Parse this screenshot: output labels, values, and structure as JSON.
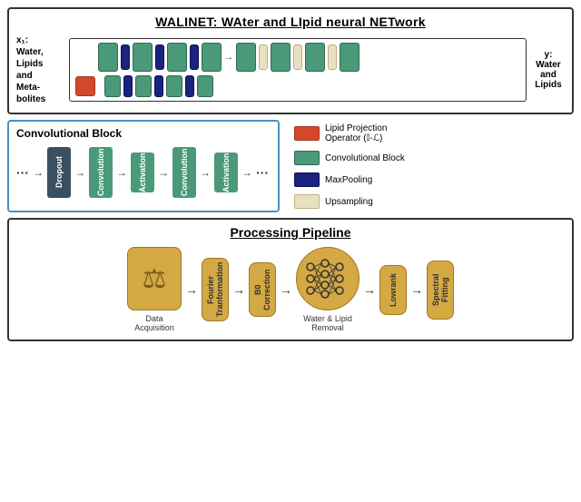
{
  "walinet": {
    "title": "WALINET: WAter and LIpid neural NETwork",
    "x1_label": "x₁:",
    "x1_description": "Water,\nLipids\nand\nMeta-\nbolites",
    "y_label": "y:",
    "y_description": "Water\nand\nLipids"
  },
  "conv_block": {
    "title": "Convolutional Block",
    "elements": [
      "Dropout",
      "Convolution",
      "Activation",
      "Convolution",
      "Activation"
    ]
  },
  "legend": {
    "items": [
      {
        "label": "Lipid Projection Operator (𝕀-ℒ)",
        "color": "lipid"
      },
      {
        "label": "Convolutional Block",
        "color": "conv"
      },
      {
        "label": "MaxPooling",
        "color": "maxpool"
      },
      {
        "label": "Upsampling",
        "color": "upsample"
      }
    ]
  },
  "pipeline": {
    "title": "Processing Pipeline",
    "steps": [
      {
        "label": "Data Acquisition",
        "type": "icon"
      },
      {
        "label": "Fourier Tranformation",
        "type": "box"
      },
      {
        "label": "B0 Correction",
        "type": "box"
      },
      {
        "label": "Water & Lipid Removal",
        "type": "network"
      },
      {
        "label": "Lowrank",
        "type": "box"
      },
      {
        "label": "Spectral Fitting",
        "type": "box"
      }
    ]
  }
}
